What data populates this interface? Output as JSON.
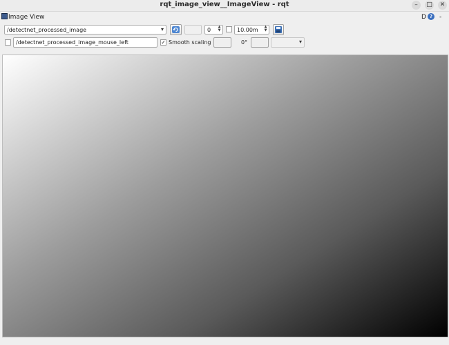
{
  "window": {
    "title": "rqt_image_view__ImageView - rqt",
    "minimize_label": "–",
    "maximize_label": "□",
    "close_label": "✕"
  },
  "plugin": {
    "title": "Image View",
    "right_d_label": "D",
    "help_label": "?",
    "right_dash_label": "-"
  },
  "toolbar": {
    "topic_value": "/detectnet_processed_image",
    "topic_arrow": "▾",
    "refresh_icon": "refresh-icon",
    "spin_value": "0",
    "spin_up": "▲",
    "spin_down": "▼",
    "rate_value": "10.00m",
    "save_icon": "save-icon",
    "mouse_topic_value": "/detectnet_processed_image_mouse_left",
    "smooth_scaling_label": "Smooth scaling",
    "smooth_scaling_checked": "✓",
    "rotation_label": "0°",
    "dropdown_arrow": "▾"
  },
  "colors": {
    "accent": "#3a6fbf",
    "window_bg": "#efefef"
  }
}
